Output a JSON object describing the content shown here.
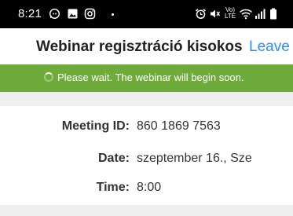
{
  "status_bar": {
    "time": "8:21",
    "volte_label": "Vo)\nLTE",
    "icons": [
      "whatsapp-icon",
      "image-icon",
      "instagram-icon",
      "alarm-icon",
      "mute-icon",
      "wifi-icon",
      "signal-icon",
      "battery-icon"
    ]
  },
  "header": {
    "title": "Webinar regisztráció kisokos",
    "leave_label": "Leave"
  },
  "banner": {
    "message": "Please wait. The webinar will begin soon.",
    "color": "#6fab3a"
  },
  "details": [
    {
      "label": "Meeting ID:",
      "value": "860 1869 7563"
    },
    {
      "label": "Date:",
      "value": "szeptember 16., Sze"
    },
    {
      "label": "Time:",
      "value": "8:00"
    }
  ],
  "colors": {
    "accent": "#2d8cff",
    "band": "#efefef",
    "status_bar": "#000000"
  }
}
